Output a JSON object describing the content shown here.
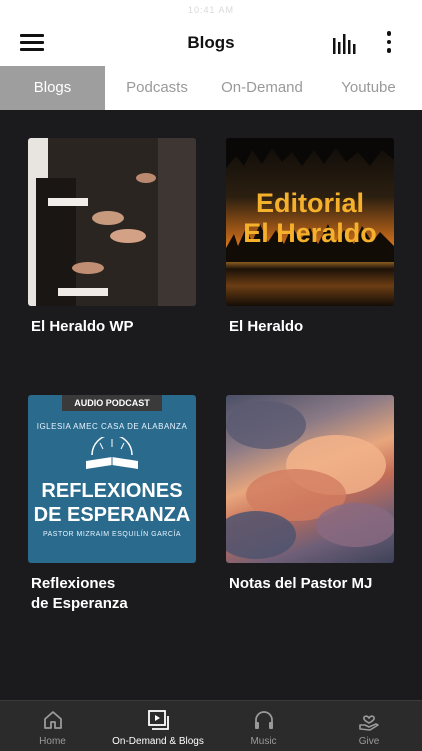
{
  "status": {
    "time": "10:41 AM"
  },
  "header": {
    "title": "Blogs"
  },
  "tabs": [
    {
      "label": "Blogs",
      "active": true
    },
    {
      "label": "Podcasts",
      "active": false
    },
    {
      "label": "On-Demand",
      "active": false
    },
    {
      "label": "Youtube",
      "active": false
    }
  ],
  "cards": [
    {
      "title": "El Heraldo WP"
    },
    {
      "title": "El Heraldo",
      "image_text": [
        "Editorial",
        "El Heraldo"
      ]
    },
    {
      "title_lines": [
        "Reflexiones",
        "de Esperanza"
      ],
      "image_text": {
        "badge": "AUDIO PODCAST",
        "church": "IGLESIA AMEC CASA DE ALABANZA",
        "title_lines": [
          "REFLEXIONES",
          "DE ESPERANZA"
        ],
        "pastor": "PASTOR MIZRAIM ESQUILÍN GARCÍA"
      }
    },
    {
      "title": "Notas del Pastor MJ"
    }
  ],
  "bottom_nav": [
    {
      "label": "Home",
      "icon": "home-icon",
      "active": false
    },
    {
      "label": "On-Demand & Blogs",
      "icon": "play-library-icon",
      "active": true
    },
    {
      "label": "Music",
      "icon": "headphones-icon",
      "active": false
    },
    {
      "label": "Give",
      "icon": "hand-heart-icon",
      "active": false
    }
  ],
  "colors": {
    "accent_tab": "#9e9e9e",
    "background": "#1b1b1d",
    "ed_text": "#f5b12c"
  }
}
